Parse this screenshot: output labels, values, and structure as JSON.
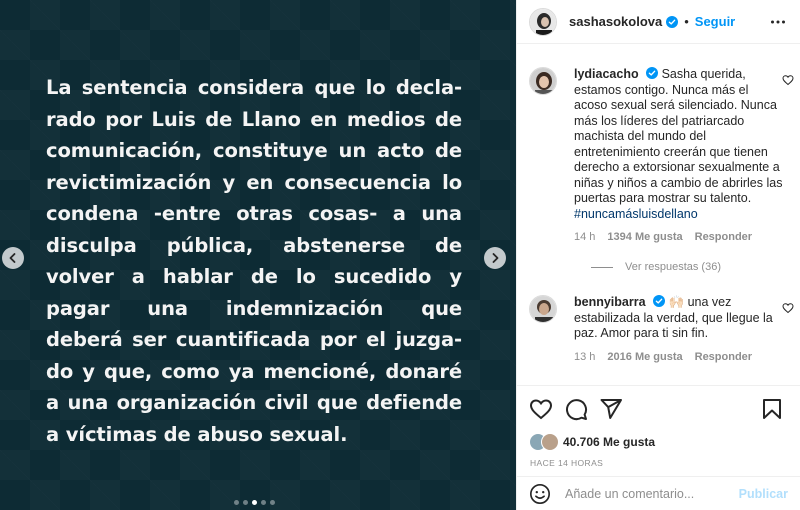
{
  "post": {
    "text_lines": [
      "La sentencia considera que lo decla-",
      "rado por Luis de Llano en medios de",
      "comunicación, constituye un acto de",
      "revictimización y en consecuencia lo",
      "condena -entre otras cosas- a una",
      "disculpa pública, abstenerse de",
      "volver a hablar de lo sucedido y",
      "pagar una indemnización que",
      "deberá ser cuantificada por el juzga-",
      "do y que, como ya mencioné, donaré",
      "a una organización civil que defiende",
      "a víctimas de abuso sexual."
    ],
    "slide_count": 5,
    "active_slide": 3,
    "background_color": "#0d2b34"
  },
  "header": {
    "username": "sashasokolova",
    "separator": "•",
    "follow_label": "Seguir",
    "verified_icon": "verified-badge-icon",
    "more_icon": "more-options-icon"
  },
  "comments": [
    {
      "username": "lydiacacho",
      "verified": true,
      "text": "Sasha querida, estamos contigo. Nunca más el acoso sexual será silenciado. Nunca más los líderes del patriarcado machista del mundo del entretenimiento creerán que tienen derecho a extorsionar sexualmente a niñas y niños a cambio de abrirles las puertas para mostrar su talento.",
      "hashtag": "#nuncamásluisdellano",
      "time": "14 h",
      "likes": "1394 Me gusta",
      "reply_label": "Responder",
      "replies_label": "Ver respuestas (36)"
    },
    {
      "username": "bennyibarra",
      "verified": true,
      "emoji": "🙌🏻",
      "text": "una vez estabilizada la verdad, que llegue la paz. Amor para ti sin fin.",
      "time": "13 h",
      "likes": "2016 Me gusta",
      "reply_label": "Responder"
    }
  ],
  "actions": {
    "icons": [
      "heart-icon",
      "comment-icon",
      "share-icon",
      "bookmark-icon"
    ]
  },
  "likes": {
    "count_label": "40.706 Me gusta"
  },
  "time_ago": "HACE 14 HORAS",
  "add_comment": {
    "placeholder": "Añade un comentario...",
    "publish_label": "Publicar"
  },
  "colors": {
    "accent": "#0095f6",
    "verified": "#0095f6",
    "publish_disabled": "#b2dffc",
    "muted_text": "#8e8e8e"
  }
}
